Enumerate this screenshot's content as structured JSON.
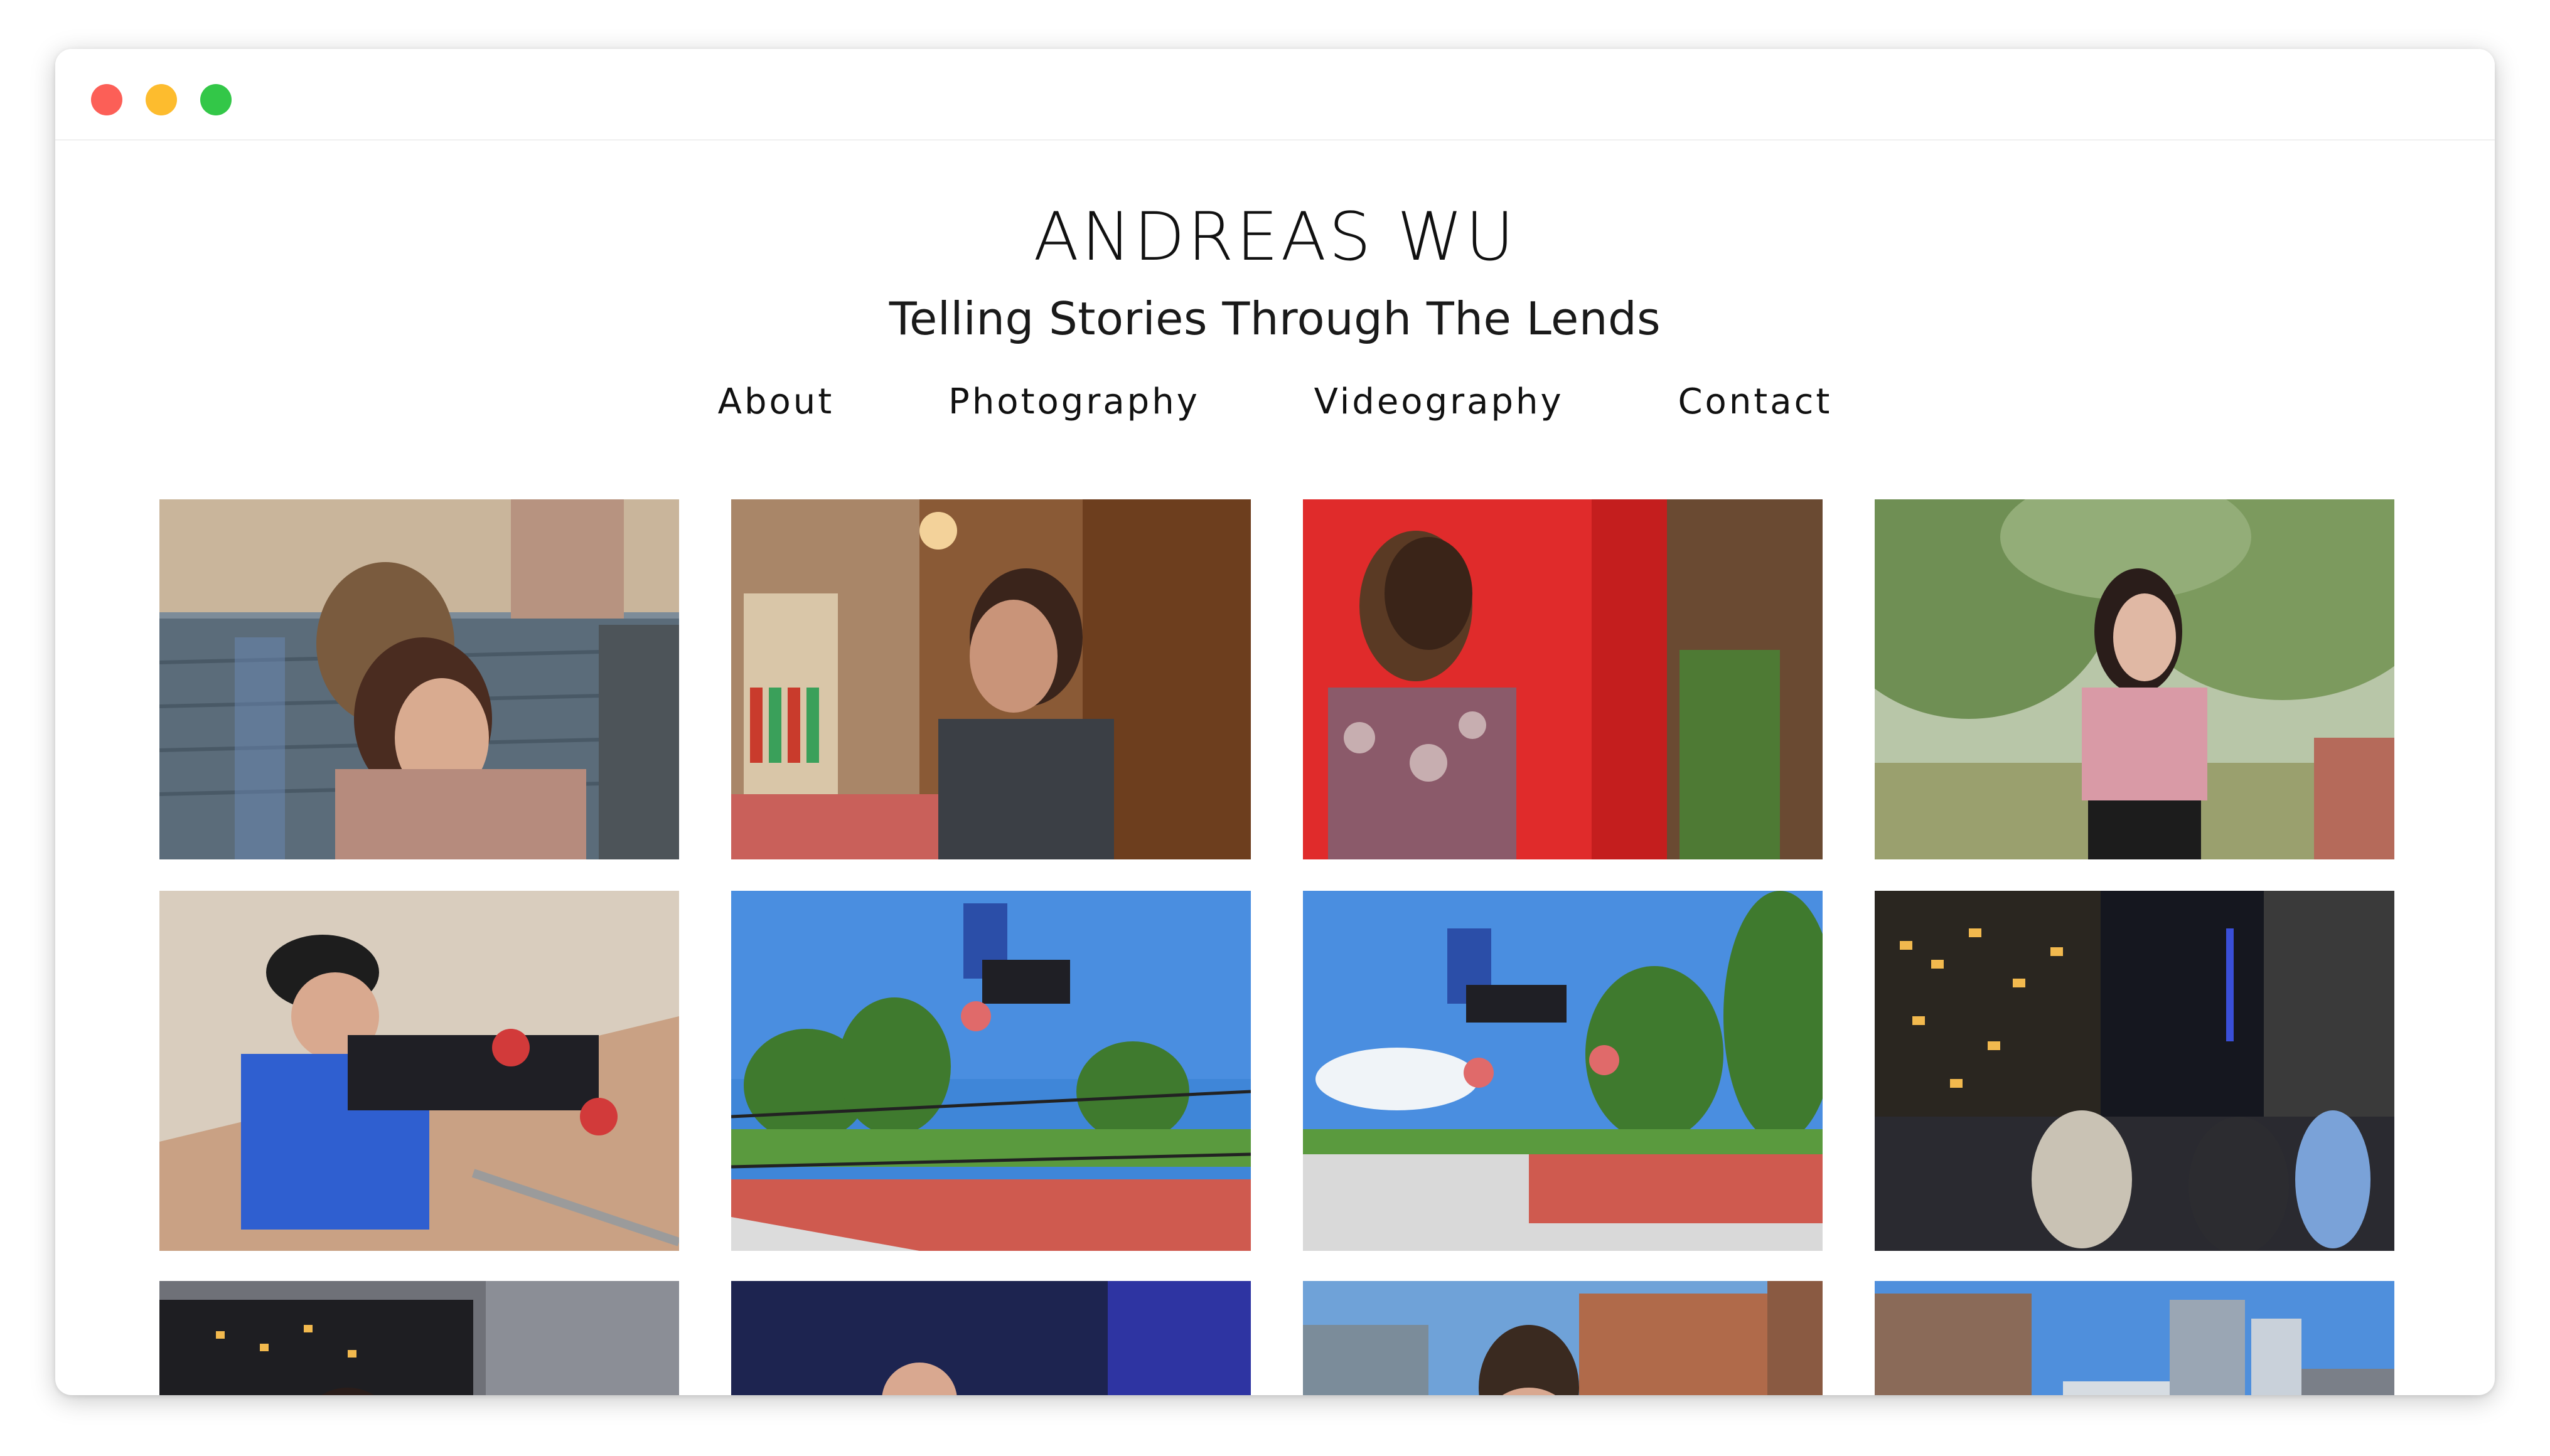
{
  "window": {
    "controls": [
      "close",
      "minimize",
      "zoom"
    ]
  },
  "header": {
    "title": "ANDREAS WU",
    "tagline": "Telling Stories Through The Lends"
  },
  "nav": {
    "items": [
      {
        "label": "About"
      },
      {
        "label": "Photography"
      },
      {
        "label": "Videography"
      },
      {
        "label": "Contact"
      }
    ]
  },
  "gallery": {
    "photos": [
      {
        "subject": "woman-with-man-brick-wall",
        "palette": "urban-blue"
      },
      {
        "subject": "woman-in-bar",
        "palette": "warm-wood"
      },
      {
        "subject": "man-red-door",
        "palette": "red"
      },
      {
        "subject": "woman-in-park",
        "palette": "green-trees"
      },
      {
        "subject": "skater-sitting",
        "palette": "concrete"
      },
      {
        "subject": "skater-jumping-sky",
        "palette": "blue-sky"
      },
      {
        "subject": "skater-jumping-ramp",
        "palette": "blue-sky"
      },
      {
        "subject": "rooftop-party-night",
        "palette": "night-city"
      },
      {
        "subject": "woman-by-window",
        "palette": "dark-window"
      },
      {
        "subject": "man-at-party",
        "palette": "blue-party"
      },
      {
        "subject": "man-city-buildings",
        "palette": "brick-city"
      },
      {
        "subject": "city-skyline",
        "palette": "sky-buildings"
      }
    ]
  }
}
